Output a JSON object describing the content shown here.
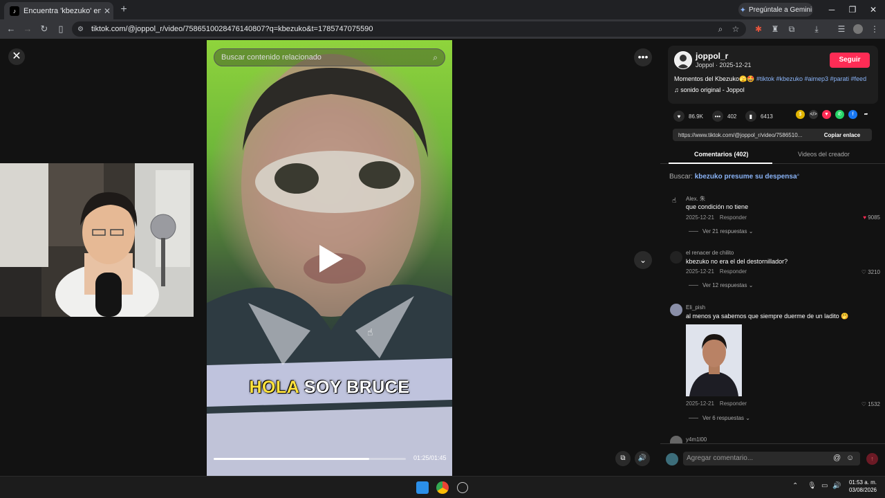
{
  "browser": {
    "tab_title": "Encuentra 'kbezuko' en TikTok",
    "tab_icon": "tiktok-icon",
    "gemini_label": "Pregúntale a Gemini",
    "url": "tiktok.com/@joppol_r/video/7586510028476140807?q=kbezuko&t=1785747075590"
  },
  "video": {
    "search_placeholder": "Buscar contenido relacionado",
    "caption_highlight": "HOLA",
    "caption_rest": "SOY BRUCE",
    "time": "01:25/01:45",
    "progress": 0.81
  },
  "creator": {
    "username": "joppol_r",
    "subline": "Joppol · 2025-12-21",
    "follow_label": "Seguir",
    "description_text": "Momentos del Kbezuko🫣🤩 ",
    "hashtags": "#tiktok #kbezuko #aimep3 #parati #feed",
    "sound": "♫ sonido original - Joppol"
  },
  "stats": {
    "likes": "86.9K",
    "comments": "402",
    "saves": "6413"
  },
  "share": {
    "link": "https://www.tiktok.com/@joppol_r/video/7586510...",
    "copy_label": "Copiar enlace"
  },
  "tabs": {
    "comments": "Comentarios (402)",
    "creator_videos": "Videos del creador"
  },
  "search_hint": {
    "label": "Buscar:",
    "query": "kbezuko presume su despensa"
  },
  "comments": [
    {
      "user": "Alex. 朱",
      "text": "que condición no tiene",
      "date": "2025-12-21",
      "reply": "Responder",
      "likes": "9085",
      "replies": "Ver 21 respuestas"
    },
    {
      "user": "el renacer de chilito",
      "text": "kbezuko no era el del destornillador?",
      "date": "2025-12-21",
      "reply": "Responder",
      "likes": "3210",
      "replies": "Ver 12 respuestas"
    },
    {
      "user": "Eli_pish",
      "text": "al menos ya sabemos que siempre duerme de un ladito 🤭",
      "date": "2025-12-21",
      "reply": "Responder",
      "likes": "1532",
      "replies": "Ver 6 respuestas"
    },
    {
      "user": "y4m1l00"
    }
  ],
  "comment_input": {
    "placeholder": "Agregar comentario..."
  },
  "taskbar": {
    "time": "01:53 a. m.",
    "date": "03/08/2026"
  }
}
